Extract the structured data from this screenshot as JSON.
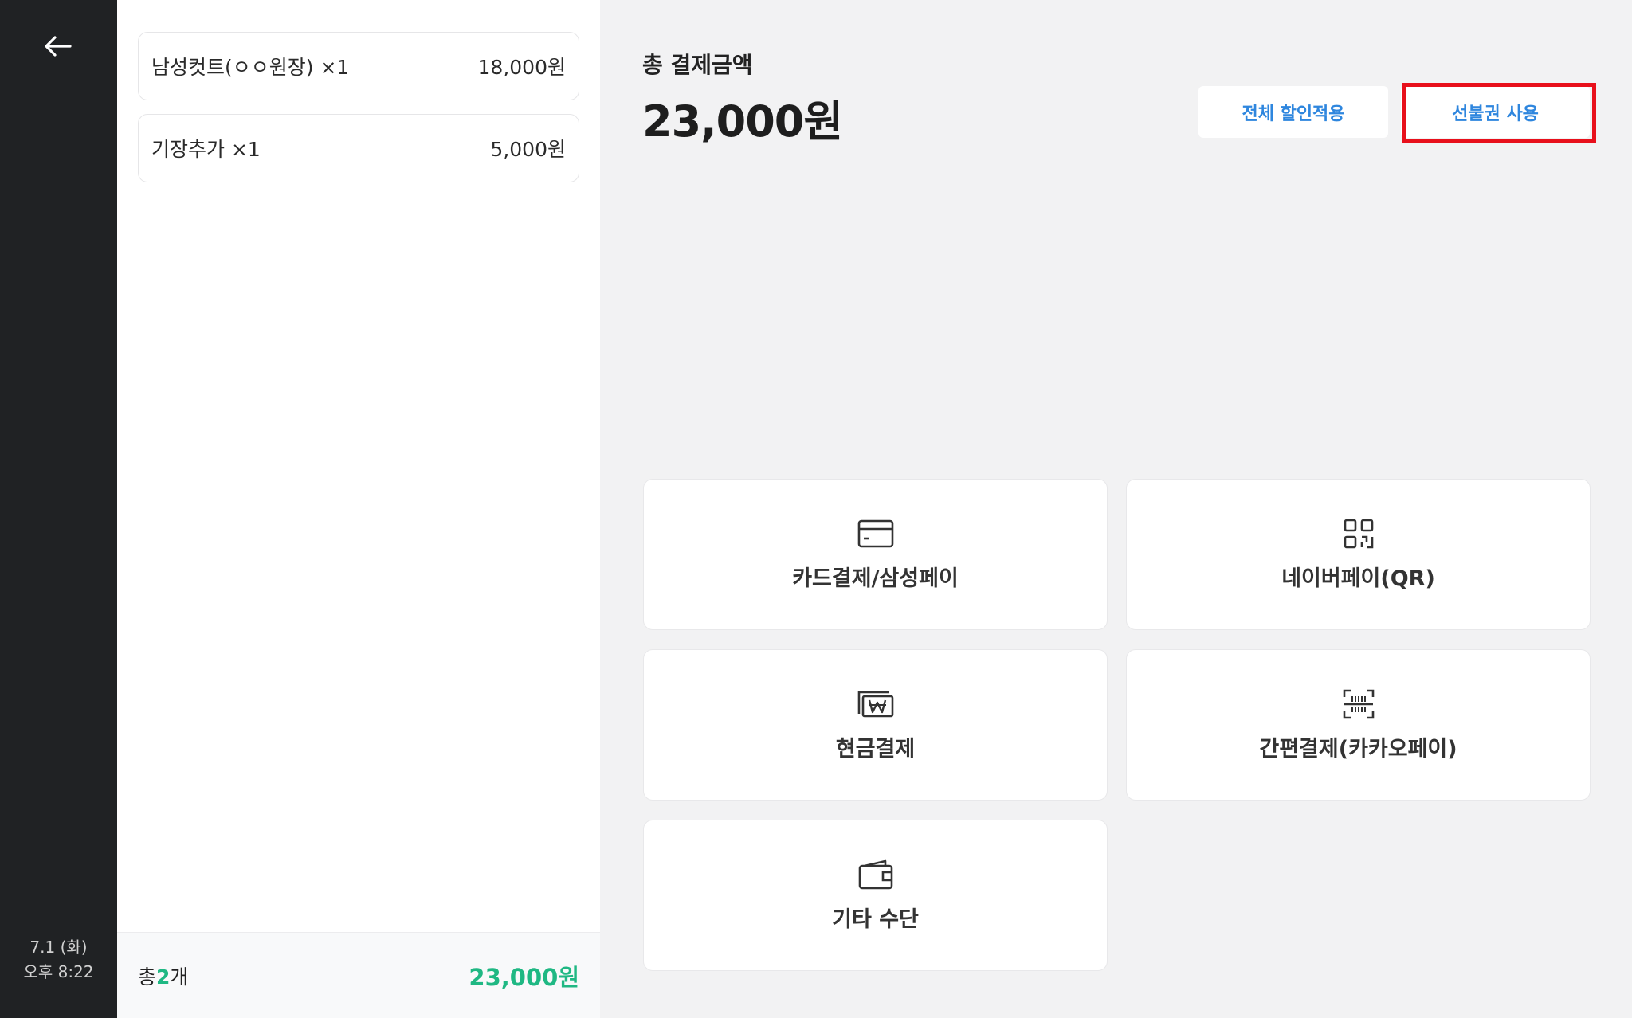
{
  "rail": {
    "date": "7.1 (화)",
    "time": "오후 8:22"
  },
  "order": {
    "items": [
      {
        "name": "남성컷트(ㅇㅇ원장) ×1",
        "price": "18,000원"
      },
      {
        "name": "기장추가 ×1",
        "price": "5,000원"
      }
    ],
    "footer": {
      "count_prefix": "총",
      "count_value": "2",
      "count_suffix": "개",
      "total": "23,000원"
    }
  },
  "summary": {
    "label": "총 결제금액",
    "amount": "23,000원",
    "discount_button": "전체 할인적용",
    "voucher_button": "선불권 사용"
  },
  "payment_methods": [
    {
      "label": "카드결제/삼성페이",
      "icon": "credit-card-icon"
    },
    {
      "label": "네이버페이(QR)",
      "icon": "qr-code-icon"
    },
    {
      "label": "현금결제",
      "icon": "cash-won-icon"
    },
    {
      "label": "간편결제(카카오페이)",
      "icon": "barcode-scan-icon"
    },
    {
      "label": "기타 수단",
      "icon": "wallet-icon"
    }
  ],
  "colors": {
    "accent_green": "#1fb883",
    "accent_blue": "#2e86de",
    "highlight_red": "#e8101b",
    "rail_bg": "#202224"
  }
}
